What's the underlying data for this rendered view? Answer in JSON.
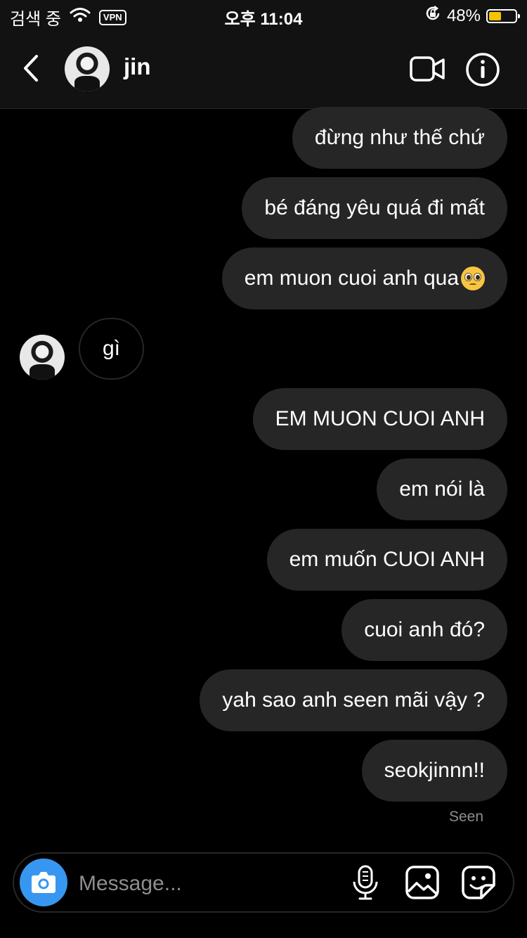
{
  "status_bar": {
    "carrier": "검색 중",
    "vpn": "VPN",
    "time": "오후 11:04",
    "battery_percent": "48%",
    "battery_level": 0.48,
    "battery_color": "#f5c400"
  },
  "header": {
    "username": "jin",
    "icons": [
      "chevron-left-icon",
      "video-camera-icon",
      "info-icon"
    ]
  },
  "messages": {
    "m1": "đừng như thế chứ",
    "m2": "bé đáng yêu quá đi mất",
    "m3": "em muon cuoi anh qua",
    "m3_emoji": "pleading-face-emoji",
    "in1": "gì",
    "m4": "EM MUON CUOI ANH",
    "m5": "em nói là",
    "m6": "em muốn CUOI ANH",
    "m7": "cuoi anh đó?",
    "m8": "yah sao anh seen mãi vậy ?",
    "m9": "seokjinnn!!"
  },
  "seen_label": "Seen",
  "composer": {
    "placeholder": "Message...",
    "camera_color": "#3797f0",
    "icons": [
      "camera-icon",
      "microphone-icon",
      "gallery-icon",
      "sticker-icon"
    ]
  },
  "colors": {
    "background": "#000000",
    "bubble": "#262626",
    "seen_text": "#8e8e8e"
  }
}
